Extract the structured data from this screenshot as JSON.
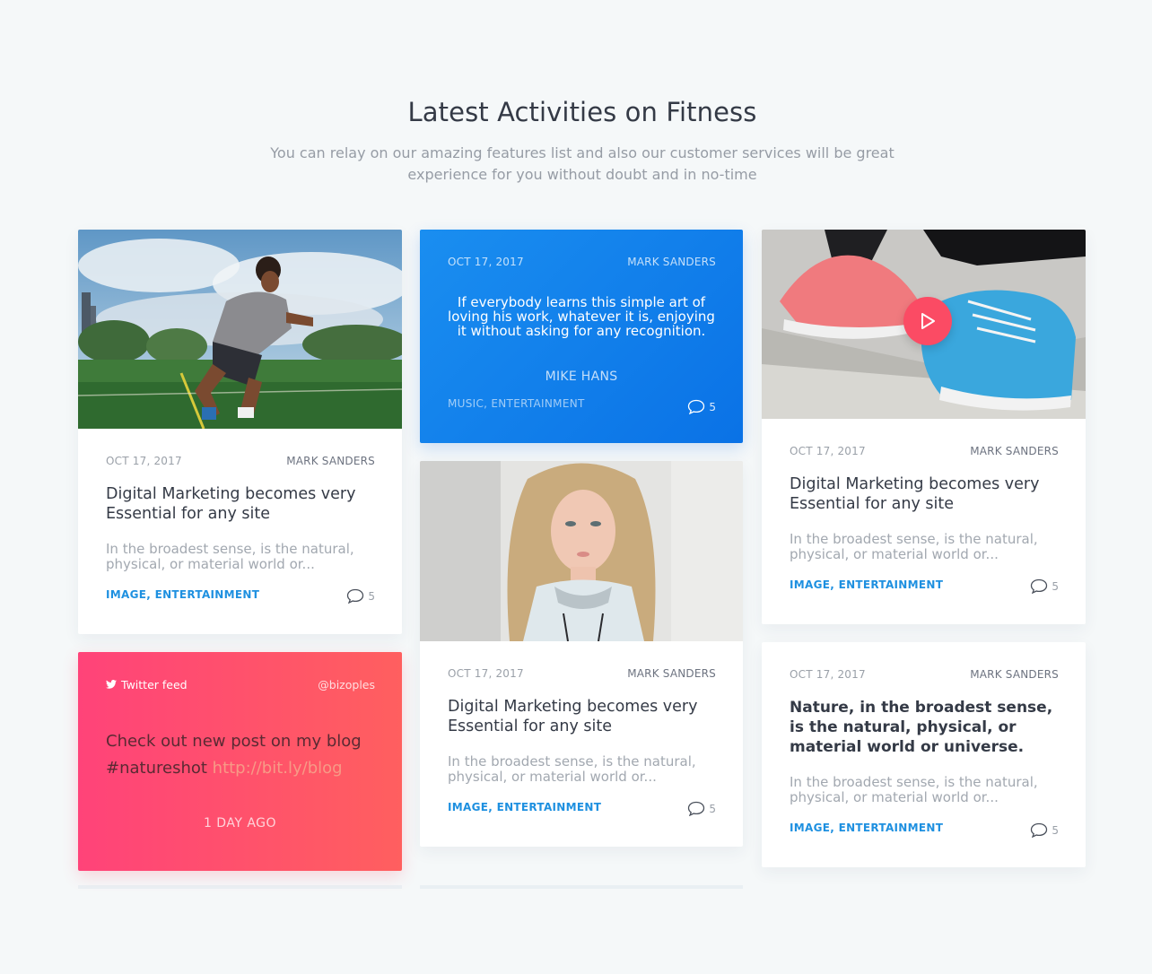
{
  "section": {
    "title": "Latest Activities on Fitness",
    "subtitle": "You can relay on our amazing features list and also our customer services will be great experience for you without doubt and in no-time"
  },
  "cards": {
    "c1": {
      "date": "OCT 17, 2017",
      "author": "MARK SANDERS",
      "title": "Digital Marketing becomes very Essential for any site",
      "excerpt": "In the broadest sense, is the natural, physical, or material world or...",
      "tags": "IMAGE, ENTERTAINMENT",
      "comments": "5"
    },
    "quote": {
      "date": "OCT 17, 2017",
      "author": "MARK SANDERS",
      "text": "If everybody learns this simple art of loving his work, whatever it is, enjoying it without asking for any recognition.",
      "quote_author": "MIKE HANS",
      "tags": "MUSIC, ENTERTAINMENT",
      "comments": "5"
    },
    "c3": {
      "date": "OCT 17, 2017",
      "author": "MARK SANDERS",
      "title": "Digital Marketing becomes very Essential for any site",
      "excerpt": "In the broadest sense, is the natural, physical, or material world or...",
      "tags": "IMAGE, ENTERTAINMENT",
      "comments": "5"
    },
    "twitter": {
      "feed_label": "Twitter feed",
      "handle": "@bizoples",
      "text": "Check out new post on my blog #natureshot",
      "link": "http://bit.ly/blog",
      "time": "1 DAY AGO"
    },
    "c5": {
      "date": "OCT 17, 2017",
      "author": "MARK SANDERS",
      "title": "Digital Marketing becomes very Essential for any site",
      "excerpt": "In the broadest sense, is the natural, physical, or material world or...",
      "tags": "IMAGE, ENTERTAINMENT",
      "comments": "5"
    },
    "c6": {
      "date": "OCT 17, 2017",
      "author": "MARK SANDERS",
      "title": "Nature, in the broadest sense, is the natural, physical, or material world or universe.",
      "excerpt": "In the broadest sense, is the natural, physical, or material world or...",
      "tags": "IMAGE, ENTERTAINMENT",
      "comments": "5"
    }
  },
  "colors": {
    "background": "#f5f8f9",
    "accent_blue": "#1e90e0",
    "quote_card": "#0a72e6",
    "twitter_card": "#ff4f6e",
    "play_button": "#fb4b64"
  },
  "icons": [
    "comment-icon",
    "twitter-bird-icon",
    "play-icon"
  ]
}
